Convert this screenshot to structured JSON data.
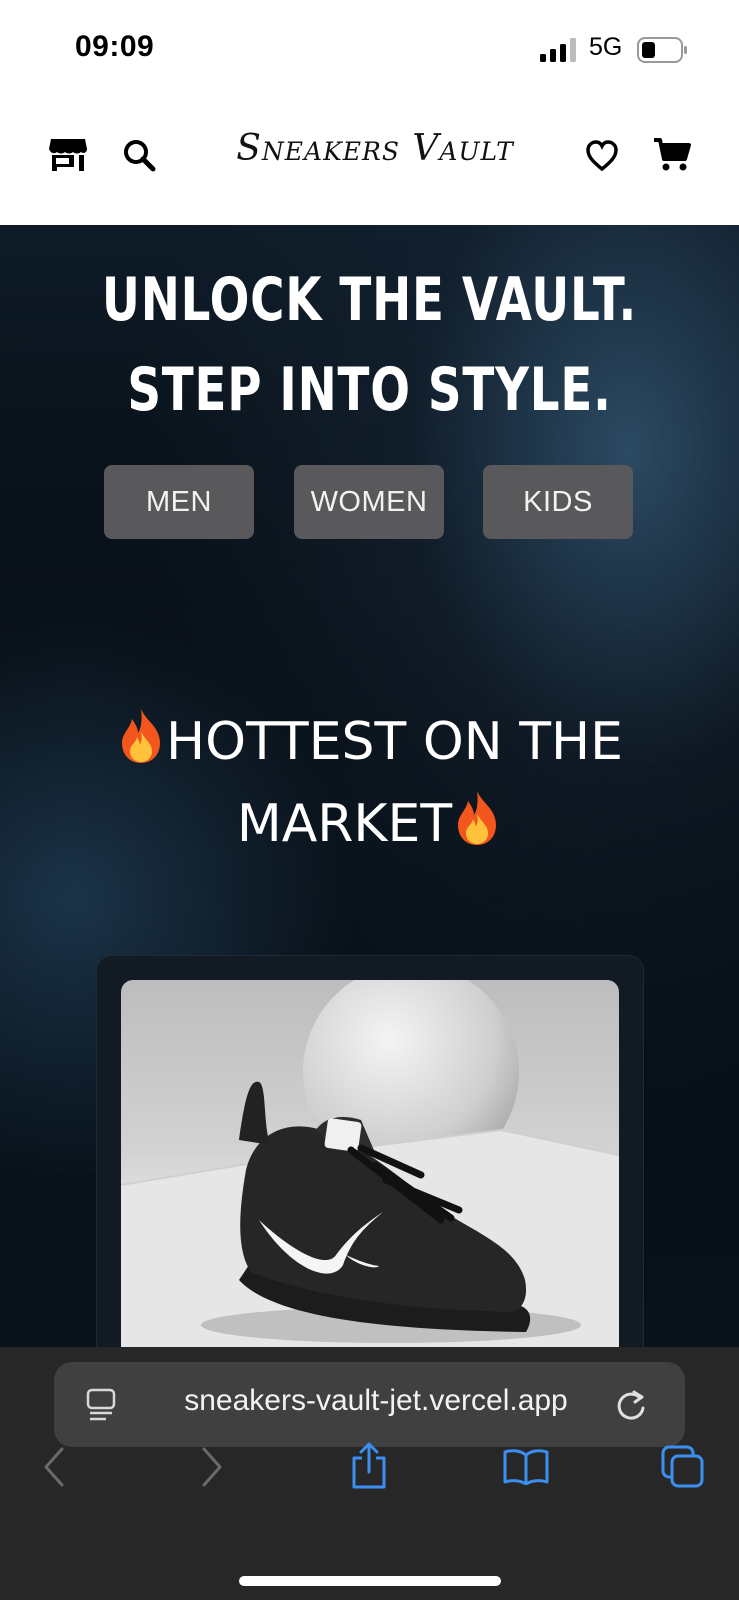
{
  "status_bar": {
    "time": "09:09",
    "network": "5G"
  },
  "header": {
    "brand": "Sneakers Vault"
  },
  "hero": {
    "headline_line1": "UNLOCK THE VAULT.",
    "headline_line2": "STEP INTO STYLE.",
    "categories": [
      "MEN",
      "WOMEN",
      "KIDS"
    ],
    "section_title_line1": "HOTTEST ON THE",
    "section_title_line2": "MARKET"
  },
  "browser": {
    "url": "sneakers-vault-jet.vercel.app"
  },
  "icons": {
    "store": "store-icon",
    "search": "search-icon",
    "wishlist": "heart-icon",
    "cart": "cart-icon",
    "reader": "reader-icon",
    "reload": "reload-icon",
    "back": "back-icon",
    "forward": "forward-icon",
    "share": "share-icon",
    "bookmarks": "bookmarks-icon",
    "tabs": "tabs-icon",
    "fire": "fire-icon"
  },
  "colors": {
    "accent": "#3b8ff0",
    "button_bg": "#59595b",
    "card_bg": "#121a24"
  }
}
